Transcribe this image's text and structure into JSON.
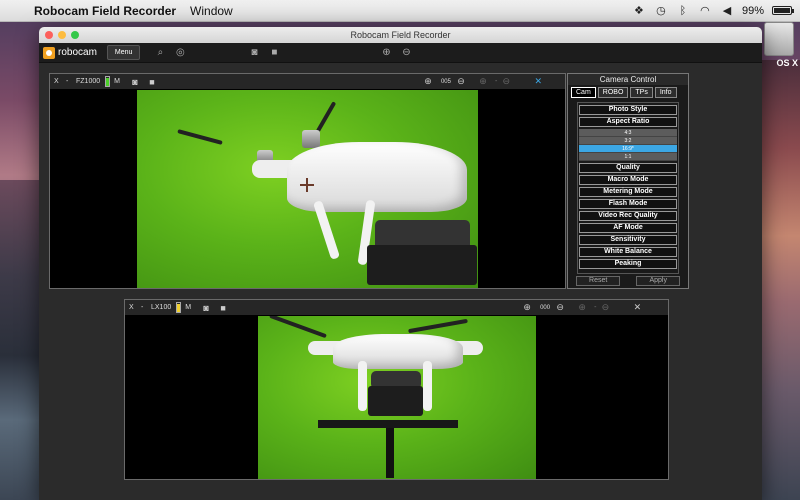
{
  "menubar": {
    "app_name": "Robocam Field Recorder",
    "menus": [
      "Window"
    ],
    "battery_percent": "99%",
    "battery_level": 0.99
  },
  "desktop": {
    "drive_label": "OS X"
  },
  "window": {
    "title": "Robocam Field Recorder",
    "logo_text": "robocam",
    "menu_button": "Menu"
  },
  "camera1": {
    "close": "X",
    "minus": "-",
    "name": "FZ1000",
    "mode": "M",
    "zoom": "005",
    "battery_level": 0.9,
    "battery_color": "#4cd02a"
  },
  "camera2": {
    "close": "X",
    "minus": "-",
    "name": "LX100",
    "mode": "M",
    "zoom": "000",
    "battery_level": 0.85,
    "battery_color": "#f0d030"
  },
  "control": {
    "title": "Camera Control",
    "tabs": [
      "Cam",
      "ROBO",
      "TPs",
      "Info"
    ],
    "items": [
      "Photo Style",
      "Aspect Ratio",
      "Quality",
      "Macro Mode",
      "Metering Mode",
      "Flash Mode",
      "Video Rec Quality",
      "AF Mode",
      "Sensitivity",
      "White Balance",
      "Peaking"
    ],
    "aspect_options": [
      "4:3",
      "3:2",
      "16:9*",
      "1:1"
    ],
    "selected_aspect": "16:9*",
    "reset": "Reset",
    "apply": "Apply"
  },
  "colors": {
    "selected": "#3ca7e4",
    "green_screen": "#5bb319"
  }
}
